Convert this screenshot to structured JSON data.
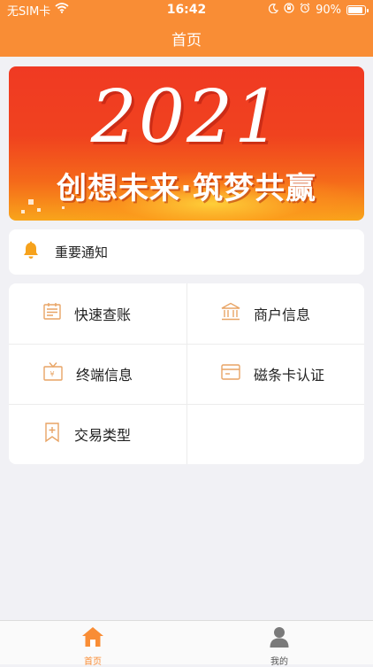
{
  "status": {
    "carrier": "无SIM卡",
    "time": "16:42",
    "battery": "90%",
    "battery_level": 0.9
  },
  "nav": {
    "title": "首页"
  },
  "banner": {
    "year": "2021",
    "slogan": "创想未来·筑梦共赢"
  },
  "notice": {
    "label": "重要通知",
    "icon": "bell-icon"
  },
  "menu": {
    "items": [
      {
        "label": "快速查账",
        "icon": "ledger-icon"
      },
      {
        "label": "商户信息",
        "icon": "bank-icon"
      },
      {
        "label": "终端信息",
        "icon": "terminal-icon"
      },
      {
        "label": "磁条卡认证",
        "icon": "card-icon"
      },
      {
        "label": "交易类型",
        "icon": "bookmark-plus-icon"
      }
    ]
  },
  "tabbar": {
    "tabs": [
      {
        "label": "首页",
        "icon": "home-icon",
        "active": true
      },
      {
        "label": "我的",
        "icon": "user-icon",
        "active": false
      }
    ]
  },
  "colors": {
    "brand": "#f98d35",
    "icon": "#e8a465",
    "tab_inactive": "#7a7a7a"
  }
}
